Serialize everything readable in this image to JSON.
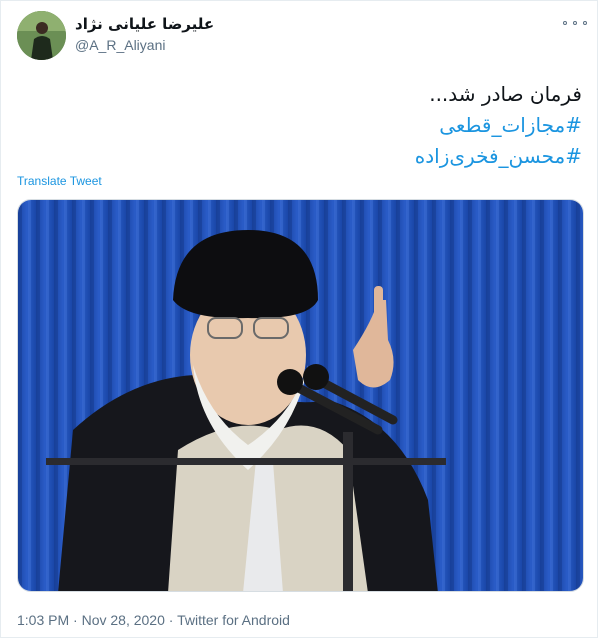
{
  "author": {
    "display_name": "علیرضا علیانی نژاد",
    "handle": "@A_R_Aliyani"
  },
  "tweet": {
    "text_line": "فرمان صادر شد...",
    "hashtags": [
      "#مجازات_قطعی",
      "#محسن_فخری‌زاده"
    ]
  },
  "translate_label": "Translate Tweet",
  "meta": {
    "time": "1:03 PM",
    "separator": "·",
    "date": "Nov 28, 2020",
    "source": "Twitter for Android"
  },
  "colors": {
    "link": "#1b95e0",
    "secondary_text": "#5b7083",
    "curtain_blue": "#1f4fb4"
  },
  "icons": {
    "more": "more-horizontal-icon"
  }
}
